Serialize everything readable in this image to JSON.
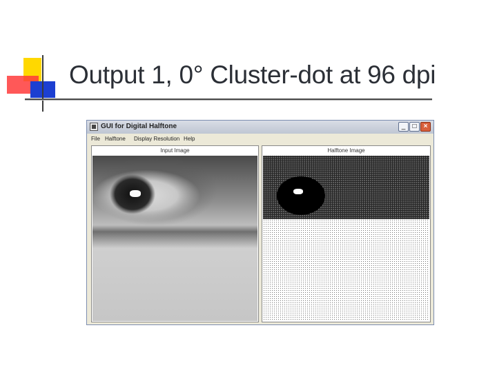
{
  "slide": {
    "title": "Output 1, 0° Cluster-dot at 96 dpi"
  },
  "window": {
    "title": "GUI for Digital Halftone",
    "controls": {
      "minimize": "_",
      "maximize": "□",
      "close": "×"
    },
    "menu": [
      "File",
      "Halftone",
      "Display Resolution",
      "Help"
    ]
  },
  "panels": {
    "input_label": "Input Image",
    "output_label": "Halftone Image"
  },
  "colors": {
    "title_text": "#2b2f36",
    "accent_yellow": "#ffd800",
    "accent_red": "#ff3b3b",
    "accent_blue": "#1c3fd1"
  }
}
